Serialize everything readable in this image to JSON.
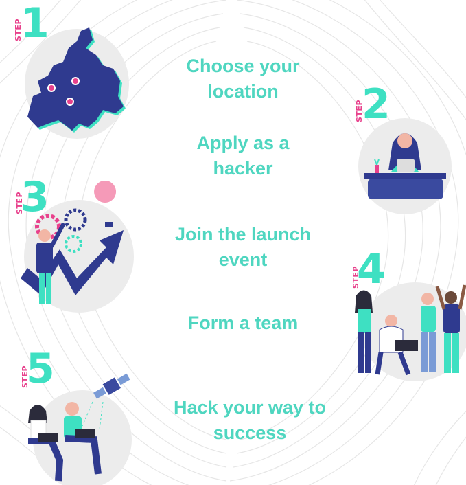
{
  "steps": [
    {
      "word": "STEP",
      "number": "1",
      "label": "Choose your location"
    },
    {
      "word": "STEP",
      "number": "2",
      "label": "Apply as a hacker"
    },
    {
      "word": "STEP",
      "number": "3",
      "label": "Join the launch event"
    },
    {
      "word": "STEP",
      "number": "4",
      "label": "Form a team"
    },
    {
      "word": "STEP",
      "number": "5",
      "label": "Hack your way to success"
    }
  ],
  "labels": {
    "l1a": "Choose your",
    "l1b": "location",
    "l2a": "Apply as a",
    "l2b": "hacker",
    "l3a": "Join the launch",
    "l3b": "event",
    "l4a": "Form a team",
    "l5a": "Hack your way to",
    "l5b": "success"
  },
  "colors": {
    "teal": "#3ee0c2",
    "pink": "#e8418c",
    "navy": "#2f3a8f",
    "blob": "#ececec"
  }
}
